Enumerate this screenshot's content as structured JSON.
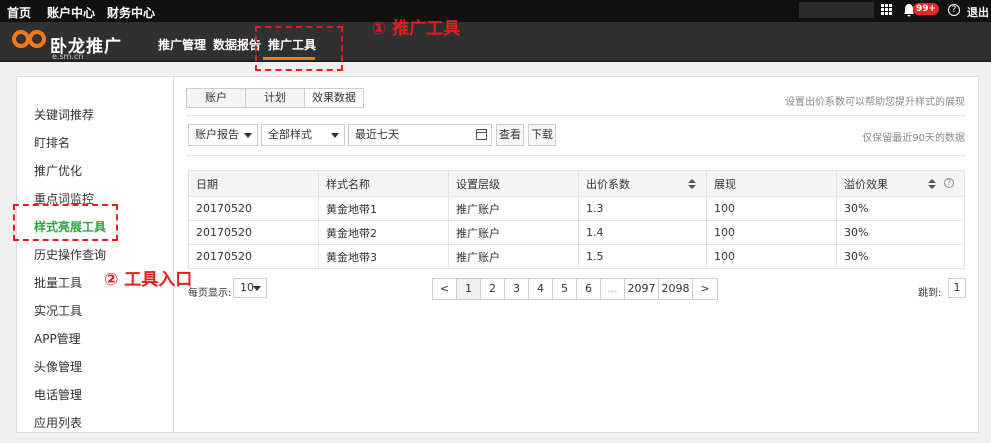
{
  "topbar": {
    "nav": [
      "首页",
      "账户中心",
      "财务中心"
    ],
    "badge": "99+",
    "help": "?",
    "logout": "退出"
  },
  "header": {
    "logo_text": "卧龙推广",
    "logo_sub": "e.sm.cn",
    "nav": [
      "推广管理",
      "数据报告",
      "推广工具"
    ],
    "active_nav": "推广工具"
  },
  "annotations": {
    "a1": "① 推广工具",
    "a2": "② 工具入口"
  },
  "sidebar": {
    "items": [
      "关键词推荐",
      "盯排名",
      "推广优化",
      "重点词监控",
      "样式亮展工具",
      "历史操作查询",
      "批量工具",
      "实况工具",
      "APP管理",
      "头像管理",
      "电话管理",
      "应用列表"
    ],
    "active": "样式亮展工具"
  },
  "tabs": [
    "账户",
    "计划",
    "效果数据"
  ],
  "active_tab": "效果数据",
  "hint_top": "设置出价系数可以帮助您提升样式的展现",
  "filters": {
    "report": "账户报告",
    "style": "全部样式",
    "date": "最近七天",
    "view": "查看",
    "download": "下载",
    "note": "仅保留最近90天的数据"
  },
  "table": {
    "headers": [
      "日期",
      "样式名称",
      "设置层级",
      "出价系数",
      "展现",
      "溢价效果"
    ],
    "rows": [
      [
        "20170520",
        "黄金地带1",
        "推广账户",
        "1.3",
        "100",
        "30%"
      ],
      [
        "20170520",
        "黄金地带2",
        "推广账户",
        "1.4",
        "100",
        "30%"
      ],
      [
        "20170520",
        "黄金地带3",
        "推广账户",
        "1.5",
        "100",
        "30%"
      ]
    ]
  },
  "pagination": {
    "per_page_label": "每页显示:",
    "per_page": "10",
    "prev": "<",
    "pages": [
      "1",
      "2",
      "3",
      "4",
      "5",
      "6",
      "...",
      "2097",
      "2098"
    ],
    "next": ">",
    "jump_label": "跳到:",
    "jump_value": "1"
  },
  "colors": {
    "accent_green": "#2aa640",
    "accent_orange": "#f07a1a",
    "annotation_red": "#e02020"
  }
}
